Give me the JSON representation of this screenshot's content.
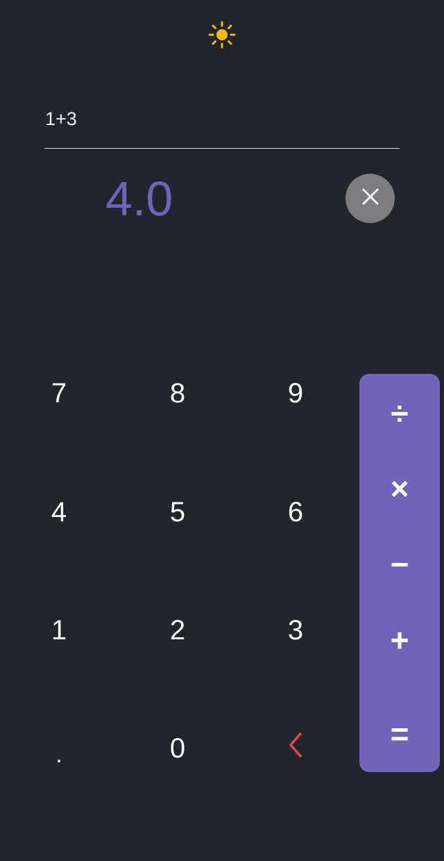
{
  "header": {
    "theme_icon": "sun-icon",
    "sun_color": "#f5b90f"
  },
  "display": {
    "expression": "1+3",
    "result": "4.0",
    "clear_icon": "close-icon"
  },
  "keypad": {
    "rows": [
      [
        "7",
        "8",
        "9"
      ],
      [
        "4",
        "5",
        "6"
      ],
      [
        "1",
        "2",
        "3"
      ],
      [
        ".",
        "0",
        "backspace-icon"
      ]
    ]
  },
  "operators": [
    "÷",
    "×",
    "−",
    "+",
    "="
  ],
  "colors": {
    "background": "#23252e",
    "accent": "#7163b8",
    "backspace": "#e14b4b",
    "clear_button": "#7d7d80"
  }
}
